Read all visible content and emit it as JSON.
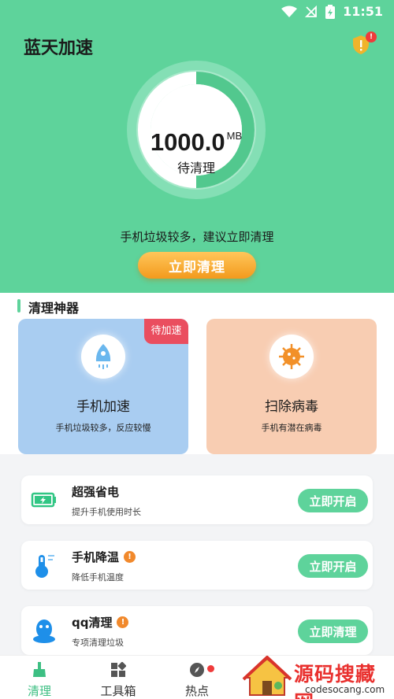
{
  "statusbar": {
    "time": "11:51"
  },
  "app": {
    "title": "蓝天加速",
    "alert_badge": "!"
  },
  "cleanup": {
    "value": "1000.0",
    "unit": "MB",
    "label": "待清理",
    "hint": "手机垃圾较多，建议立即清理",
    "button": "立即清理"
  },
  "tools": {
    "section_title": "清理神器",
    "cards": [
      {
        "badge": "待加速",
        "title": "手机加速",
        "subtitle": "手机垃圾较多，反应较慢"
      },
      {
        "title": "扫除病毒",
        "subtitle": "手机有潜在病毒"
      }
    ]
  },
  "list": [
    {
      "title": "超强省电",
      "subtitle": "提升手机使用时长",
      "button": "立即开启",
      "warn": false
    },
    {
      "title": "手机降温",
      "subtitle": "降低手机温度",
      "button": "立即开启",
      "warn": true,
      "warn_mark": "!"
    },
    {
      "title": "qq清理",
      "subtitle": "专项清理垃圾",
      "button": "立即清理",
      "warn": true,
      "warn_mark": "!"
    }
  ],
  "nav": [
    {
      "label": "清理",
      "active": true
    },
    {
      "label": "工具箱",
      "active": false
    },
    {
      "label": "热点",
      "active": false
    }
  ],
  "watermark": {
    "text": "源码搜藏网",
    "url": "codesocang.com"
  },
  "colors": {
    "primary": "#5ed39b",
    "orange": "#f39a1d",
    "badge_red": "#ea4e5f"
  }
}
